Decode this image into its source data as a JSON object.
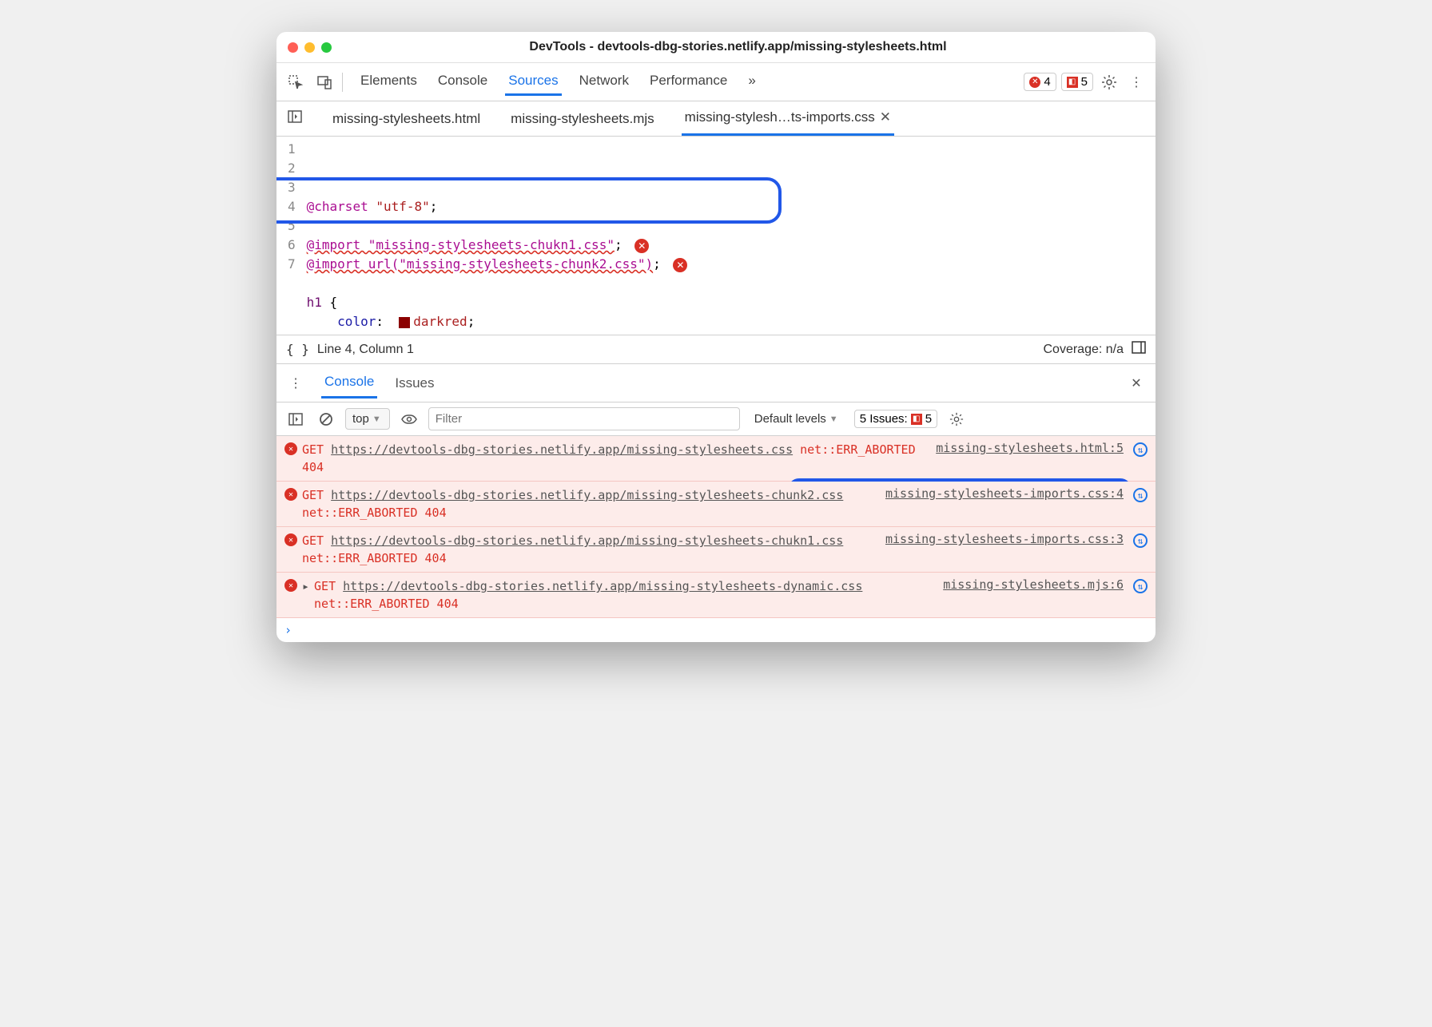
{
  "window": {
    "title": "DevTools - devtools-dbg-stories.netlify.app/missing-stylesheets.html"
  },
  "toolbar": {
    "tabs": [
      "Elements",
      "Console",
      "Sources",
      "Network",
      "Performance"
    ],
    "active_tab": "Sources",
    "more": "»",
    "error_count": "4",
    "issue_count": "5"
  },
  "filetabs": {
    "items": [
      {
        "label": "missing-stylesheets.html"
      },
      {
        "label": "missing-stylesheets.mjs"
      },
      {
        "label": "missing-stylesh…ts-imports.css",
        "active": true
      }
    ]
  },
  "editor": {
    "lines": [
      {
        "n": "1",
        "html": "<span class='kw'>@charset</span> <span class='str'>\"utf-8\"</span>;"
      },
      {
        "n": "2",
        "html": ""
      },
      {
        "n": "3",
        "html": "<span class='errline'>@import \"missing-stylesheets-chukn1.css\"</span>; <span class='err-ic'>✕</span>"
      },
      {
        "n": "4",
        "html": "<span class='errline'>@import url(\"missing-stylesheets-chunk2.css\")</span>; <span class='err-ic'>✕</span>"
      },
      {
        "n": "5",
        "html": ""
      },
      {
        "n": "6",
        "html": "<span class='sel'>h1</span> {"
      },
      {
        "n": "7",
        "html": "    <span class='prop'>color</span>:  <span class='colorbox'></span><span class='str'>darkred</span>;"
      }
    ]
  },
  "status": {
    "left": "Line 4, Column 1",
    "coverage": "Coverage: n/a"
  },
  "drawer": {
    "tabs": [
      "Console",
      "Issues"
    ],
    "active": "Console"
  },
  "console_toolbar": {
    "context": "top",
    "filter_placeholder": "Filter",
    "levels": "Default levels",
    "issues_label": "5 Issues:",
    "issues_count": "5"
  },
  "console": {
    "messages": [
      {
        "get": "GET",
        "url": "https://devtools-dbg-stories.netlify.app/missing-stylesheets.css",
        "err": "net::ERR_ABORTED 404",
        "src": "missing-stylesheets.html:5"
      },
      {
        "get": "GET",
        "url": "https://devtools-dbg-stories.netlify.app/missing-stylesheets-chunk2.css",
        "err": "net::ERR_ABORTED 404",
        "src": "missing-stylesheets-imports.css:4"
      },
      {
        "get": "GET",
        "url": "https://devtools-dbg-stories.netlify.app/missing-stylesheets-chukn1.css",
        "err": "net::ERR_ABORTED 404",
        "src": "missing-stylesheets-imports.css:3"
      },
      {
        "get": "GET",
        "url": "https://devtools-dbg-stories.netlify.app/missing-stylesheets-dynamic.css",
        "err": "net::ERR_ABORTED 404",
        "src": "missing-stylesheets.mjs:6",
        "expand": true
      }
    ],
    "prompt": "›"
  }
}
